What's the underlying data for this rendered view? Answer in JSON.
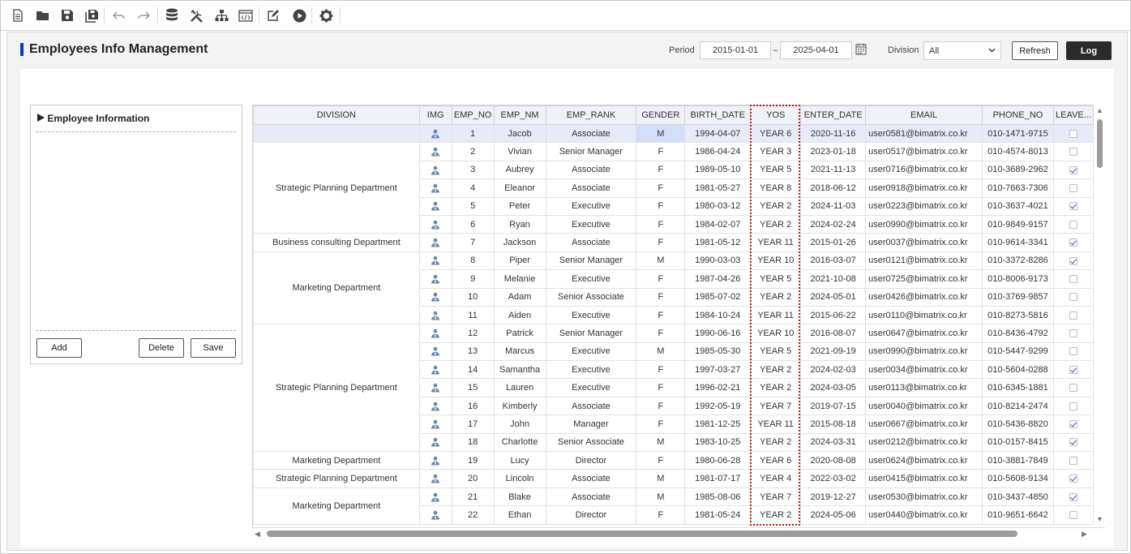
{
  "toolbar": {
    "icons": [
      "new-file-icon",
      "open-folder-icon",
      "save-icon",
      "save-all-icon",
      "undo-icon",
      "redo-icon",
      "database-icon",
      "tools-icon",
      "hierarchy-icon",
      "code-window-icon",
      "edit-icon",
      "play-icon",
      "settings-icon"
    ]
  },
  "header": {
    "title": "Employees Info Management",
    "period_label": "Period",
    "date_from": "2015-01-01",
    "date_sep": "~",
    "date_to": "2025-04-01",
    "division_label": "Division",
    "division_value": "All",
    "refresh_label": "Refresh",
    "log_label": "Log"
  },
  "left_panel": {
    "title": "Employee Information",
    "add_label": "Add",
    "delete_label": "Delete",
    "save_label": "Save"
  },
  "grid": {
    "columns": [
      "DIVISION",
      "IMG",
      "EMP_NO",
      "EMP_NM",
      "EMP_RANK",
      "GENDER",
      "BIRTH_DATE",
      "YOS",
      "ENTER_DATE",
      "EMAIL",
      "PHONE_NO",
      "LEAVE..."
    ],
    "division_groups": [
      {
        "name": "",
        "span": 1
      },
      {
        "name": "Strategic Planning Department",
        "span": 5
      },
      {
        "name": "Business consulting Department",
        "span": 1
      },
      {
        "name": "Marketing Department",
        "span": 4
      },
      {
        "name": "Strategic Planning Department",
        "span": 7
      },
      {
        "name": "Marketing Department",
        "span": 1
      },
      {
        "name": "Strategic Planning Department",
        "span": 1
      },
      {
        "name": "Marketing Department",
        "span": 2
      }
    ],
    "rows": [
      {
        "no": "1",
        "nm": "Jacob",
        "rank": "Associate",
        "gender": "M",
        "birth": "1994-04-07",
        "yos": "YEAR 6",
        "enter": "2020-11-16",
        "email": "user0581@bimatrix.co.kr",
        "phone": "010-1471-9715",
        "leave": false
      },
      {
        "no": "2",
        "nm": "Vivian",
        "rank": "Senior Manager",
        "gender": "F",
        "birth": "1986-04-24",
        "yos": "YEAR 3",
        "enter": "2023-01-18",
        "email": "user0517@bimatrix.co.kr",
        "phone": "010-4574-8013",
        "leave": false
      },
      {
        "no": "3",
        "nm": "Aubrey",
        "rank": "Associate",
        "gender": "F",
        "birth": "1989-05-10",
        "yos": "YEAR 5",
        "enter": "2021-11-13",
        "email": "user0716@bimatrix.co.kr",
        "phone": "010-3689-2962",
        "leave": true
      },
      {
        "no": "4",
        "nm": "Eleanor",
        "rank": "Associate",
        "gender": "F",
        "birth": "1981-05-27",
        "yos": "YEAR 8",
        "enter": "2018-06-12",
        "email": "user0918@bimatrix.co.kr",
        "phone": "010-7663-7306",
        "leave": false
      },
      {
        "no": "5",
        "nm": "Peter",
        "rank": "Executive",
        "gender": "F",
        "birth": "1980-03-12",
        "yos": "YEAR 2",
        "enter": "2024-11-03",
        "email": "user0223@bimatrix.co.kr",
        "phone": "010-3637-4021",
        "leave": true
      },
      {
        "no": "6",
        "nm": "Ryan",
        "rank": "Executive",
        "gender": "F",
        "birth": "1984-02-07",
        "yos": "YEAR 2",
        "enter": "2024-02-24",
        "email": "user0990@bimatrix.co.kr",
        "phone": "010-9849-9157",
        "leave": false
      },
      {
        "no": "7",
        "nm": "Jackson",
        "rank": "Associate",
        "gender": "F",
        "birth": "1981-05-12",
        "yos": "YEAR 11",
        "enter": "2015-01-26",
        "email": "user0037@bimatrix.co.kr",
        "phone": "010-9614-3341",
        "leave": true
      },
      {
        "no": "8",
        "nm": "Piper",
        "rank": "Senior Manager",
        "gender": "M",
        "birth": "1990-03-03",
        "yos": "YEAR 10",
        "enter": "2016-03-07",
        "email": "user0121@bimatrix.co.kr",
        "phone": "010-3372-8286",
        "leave": true
      },
      {
        "no": "9",
        "nm": "Melanie",
        "rank": "Executive",
        "gender": "F",
        "birth": "1987-04-26",
        "yos": "YEAR 5",
        "enter": "2021-10-08",
        "email": "user0725@bimatrix.co.kr",
        "phone": "010-8006-9173",
        "leave": false
      },
      {
        "no": "10",
        "nm": "Adam",
        "rank": "Senior Associate",
        "gender": "F",
        "birth": "1985-07-02",
        "yos": "YEAR 2",
        "enter": "2024-05-01",
        "email": "user0426@bimatrix.co.kr",
        "phone": "010-3769-9857",
        "leave": false
      },
      {
        "no": "11",
        "nm": "Aiden",
        "rank": "Executive",
        "gender": "F",
        "birth": "1984-10-24",
        "yos": "YEAR 11",
        "enter": "2015-06-22",
        "email": "user0110@bimatrix.co.kr",
        "phone": "010-8273-5816",
        "leave": false
      },
      {
        "no": "12",
        "nm": "Patrick",
        "rank": "Senior Manager",
        "gender": "F",
        "birth": "1990-06-16",
        "yos": "YEAR 10",
        "enter": "2016-08-07",
        "email": "user0647@bimatrix.co.kr",
        "phone": "010-8436-4792",
        "leave": false
      },
      {
        "no": "13",
        "nm": "Marcus",
        "rank": "Executive",
        "gender": "M",
        "birth": "1985-05-30",
        "yos": "YEAR 5",
        "enter": "2021-09-19",
        "email": "user0990@bimatrix.co.kr",
        "phone": "010-5447-9299",
        "leave": false
      },
      {
        "no": "14",
        "nm": "Samantha",
        "rank": "Executive",
        "gender": "F",
        "birth": "1997-03-27",
        "yos": "YEAR 2",
        "enter": "2024-02-03",
        "email": "user0034@bimatrix.co.kr",
        "phone": "010-5604-0288",
        "leave": true
      },
      {
        "no": "15",
        "nm": "Lauren",
        "rank": "Executive",
        "gender": "F",
        "birth": "1996-02-21",
        "yos": "YEAR 2",
        "enter": "2024-03-05",
        "email": "user0113@bimatrix.co.kr",
        "phone": "010-6345-1881",
        "leave": false
      },
      {
        "no": "16",
        "nm": "Kimberly",
        "rank": "Associate",
        "gender": "F",
        "birth": "1992-05-19",
        "yos": "YEAR 7",
        "enter": "2019-07-15",
        "email": "user0040@bimatrix.co.kr",
        "phone": "010-8214-2474",
        "leave": false
      },
      {
        "no": "17",
        "nm": "John",
        "rank": "Manager",
        "gender": "F",
        "birth": "1981-12-25",
        "yos": "YEAR 11",
        "enter": "2015-08-18",
        "email": "user0667@bimatrix.co.kr",
        "phone": "010-5436-8820",
        "leave": true
      },
      {
        "no": "18",
        "nm": "Charlotte",
        "rank": "Senior Associate",
        "gender": "M",
        "birth": "1983-10-25",
        "yos": "YEAR 2",
        "enter": "2024-03-31",
        "email": "user0212@bimatrix.co.kr",
        "phone": "010-0157-8415",
        "leave": true
      },
      {
        "no": "19",
        "nm": "Lucy",
        "rank": "Director",
        "gender": "F",
        "birth": "1980-06-28",
        "yos": "YEAR 6",
        "enter": "2020-08-08",
        "email": "user0624@bimatrix.co.kr",
        "phone": "010-3881-7849",
        "leave": false
      },
      {
        "no": "20",
        "nm": "Lincoln",
        "rank": "Associate",
        "gender": "M",
        "birth": "1981-07-17",
        "yos": "YEAR 4",
        "enter": "2022-03-02",
        "email": "user0415@bimatrix.co.kr",
        "phone": "010-5608-9134",
        "leave": true
      },
      {
        "no": "21",
        "nm": "Blake",
        "rank": "Associate",
        "gender": "M",
        "birth": "1985-08-06",
        "yos": "YEAR 7",
        "enter": "2019-12-27",
        "email": "user0530@bimatrix.co.kr",
        "phone": "010-3437-4850",
        "leave": true
      },
      {
        "no": "22",
        "nm": "Ethan",
        "rank": "Director",
        "gender": "F",
        "birth": "1981-05-24",
        "yos": "YEAR 2",
        "enter": "2024-05-06",
        "email": "user0440@bimatrix.co.kr",
        "phone": "010-9651-6642",
        "leave": false
      }
    ]
  }
}
